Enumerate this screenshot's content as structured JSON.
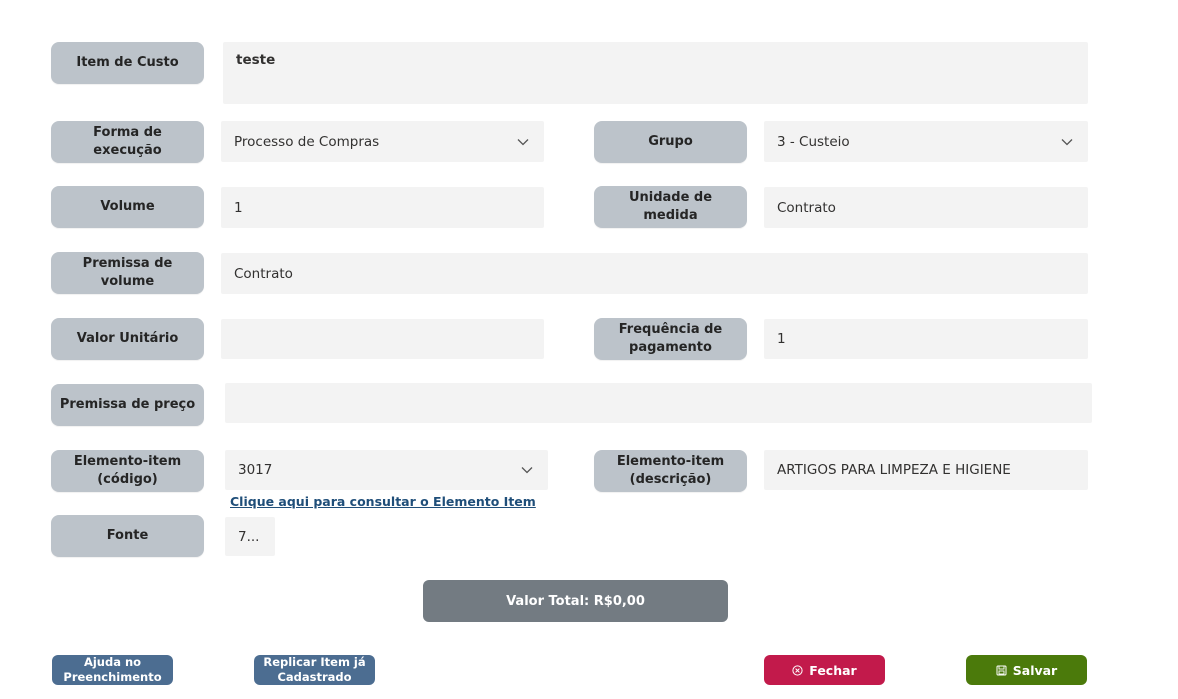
{
  "form": {
    "item_custo_label": "Item de Custo",
    "item_custo_value": "teste",
    "forma_execucao_label": "Forma de execução",
    "forma_execucao_value": "Processo de Compras",
    "grupo_label": "Grupo",
    "grupo_value": "3 - Custeio",
    "volume_label": "Volume",
    "volume_value": "1",
    "unidade_label": "Unidade de medida",
    "unidade_value": "Contrato",
    "premissa_volume_label": "Premissa de volume",
    "premissa_volume_value": "Contrato",
    "valor_unitario_label": "Valor Unitário",
    "valor_unitario_value": "",
    "frequencia_label": "Frequência de pagamento",
    "frequencia_value": "1",
    "premissa_preco_label": "Premissa de preço",
    "premissa_preco_value": "",
    "elemento_codigo_label": "Elemento-item (código)",
    "elemento_codigo_value": "3017",
    "elemento_descricao_label": "Elemento-item (descrição)",
    "elemento_descricao_value": "ARTIGOS PARA LIMPEZA E HIGIENE",
    "consultar_link": "Clique aqui para consultar o Elemento Item",
    "fonte_label": "Fonte",
    "fonte_value": "7..."
  },
  "total": {
    "label": "Valor Total: R$0,00"
  },
  "buttons": {
    "ajuda": "Ajuda no Preenchimento",
    "replicar": "Replicar Item já Cadastrado",
    "fechar": "Fechar",
    "salvar": "Salvar"
  },
  "icons": {
    "dropdown": "chevron-down-icon",
    "fechar": "close-circle-icon",
    "salvar": "save-icon"
  },
  "colors": {
    "label_bg": "#bcc3ca",
    "field_bg": "#f3f3f3",
    "total_bg": "#737b82",
    "blue_button": "#4c6d91",
    "close_button": "#c21a4b",
    "save_button": "#4b7a0b",
    "link": "#1f4e79"
  }
}
